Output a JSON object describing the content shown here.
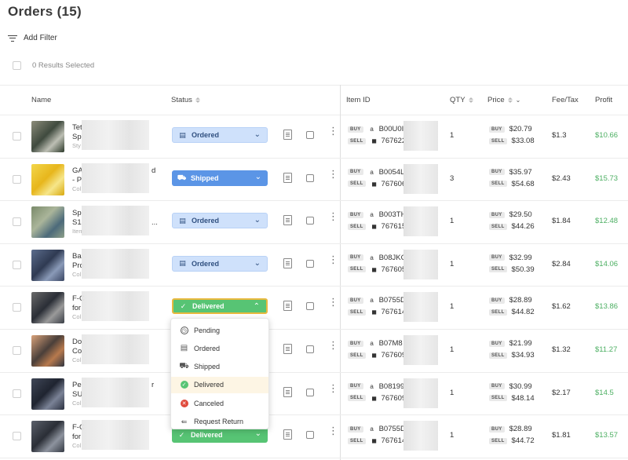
{
  "header": {
    "title": "Orders (15)",
    "add_filter": "Add Filter",
    "results_selected": "0 Results Selected"
  },
  "columns": {
    "name": "Name",
    "status": "Status",
    "item_id": "Item ID",
    "qty": "QTY",
    "price": "Price",
    "fee_tax": "Fee/Tax",
    "profit": "Profit"
  },
  "labels": {
    "buy": "BUY",
    "sell": "SELL",
    "amazon_mark": "a",
    "shop_mark": "◼"
  },
  "status_labels": {
    "ordered": "Ordered",
    "shipped": "Shipped",
    "delivered": "Delivered"
  },
  "colors": {
    "ordered_bg": "#cfe1fb",
    "shipped_bg": "#5b95e6",
    "delivered_bg": "#57c474",
    "profit": "#4caf62",
    "accent_highlight": "#e8b93f"
  },
  "icons": {
    "status_ordered": "receipt-icon",
    "status_shipped": "truck-icon",
    "status_delivered": "check-circle-icon",
    "row_notes": "notes-icon",
    "row_memo": "memo-icon",
    "row_more": "more-vertical-icon",
    "filter": "filter-icon"
  },
  "rows": [
    {
      "l1": "Tet",
      "l2": "Sp",
      "l3": "Sty",
      "suffix": "",
      "status": "Ordered",
      "buy_id": "B00U0I",
      "sell_id": "767622",
      "qty": "1",
      "buy_price": "$20.79",
      "sell_price": "$33.08",
      "fee": "$1.3",
      "profit": "$10.66"
    },
    {
      "l1": "GA",
      "l2": "- P",
      "l3": "Col",
      "suffix": "d",
      "status": "Shipped",
      "buy_id": "B0054L",
      "sell_id": "767606",
      "qty": "3",
      "buy_price": "$35.97",
      "sell_price": "$54.68",
      "fee": "$2.43",
      "profit": "$15.73"
    },
    {
      "l1": "Sp",
      "l2": "S1",
      "l3": "Item",
      "suffix": "...",
      "status": "Ordered",
      "buy_id": "B003TH",
      "sell_id": "767615",
      "qty": "1",
      "buy_price": "$29.50",
      "sell_price": "$44.26",
      "fee": "$1.84",
      "profit": "$12.48"
    },
    {
      "l1": "Ba",
      "l2": "Pro",
      "l3": "Col",
      "suffix": "",
      "status": "Ordered",
      "buy_id": "B08JKC",
      "sell_id": "767605",
      "qty": "1",
      "buy_price": "$32.99",
      "sell_price": "$50.39",
      "fee": "$2.84",
      "profit": "$14.06"
    },
    {
      "l1": "F-C",
      "l2": "for",
      "l3": "Col",
      "suffix": "",
      "status": "Delivered",
      "buy_id": "B0755D",
      "sell_id": "767614",
      "qty": "1",
      "buy_price": "$28.89",
      "sell_price": "$44.82",
      "fee": "$1.62",
      "profit": "$13.86"
    },
    {
      "l1": "Do",
      "l2": "Co",
      "l3": "Col",
      "suffix": "",
      "status": "",
      "buy_id": "B07M8",
      "sell_id": "767609",
      "qty": "1",
      "buy_price": "$21.99",
      "sell_price": "$34.93",
      "fee": "$1.32",
      "profit": "$11.27"
    },
    {
      "l1": "Pe",
      "l2": "SU",
      "l3": "Col",
      "suffix": "r",
      "status": "",
      "buy_id": "B08199",
      "sell_id": "767609",
      "qty": "1",
      "buy_price": "$30.99",
      "sell_price": "$48.14",
      "fee": "$2.17",
      "profit": "$14.5"
    },
    {
      "l1": "F-C",
      "l2": "for",
      "l3": "Col",
      "suffix": "",
      "status": "Delivered",
      "buy_id": "B0755D",
      "sell_id": "767614",
      "qty": "1",
      "buy_price": "$28.89",
      "sell_price": "$44.72",
      "fee": "$1.81",
      "profit": "$13.57"
    }
  ],
  "dropdown": {
    "options": [
      "Pending",
      "Ordered",
      "Shipped",
      "Delivered",
      "Canceled",
      "Request Return"
    ],
    "selected": "Delivered"
  }
}
